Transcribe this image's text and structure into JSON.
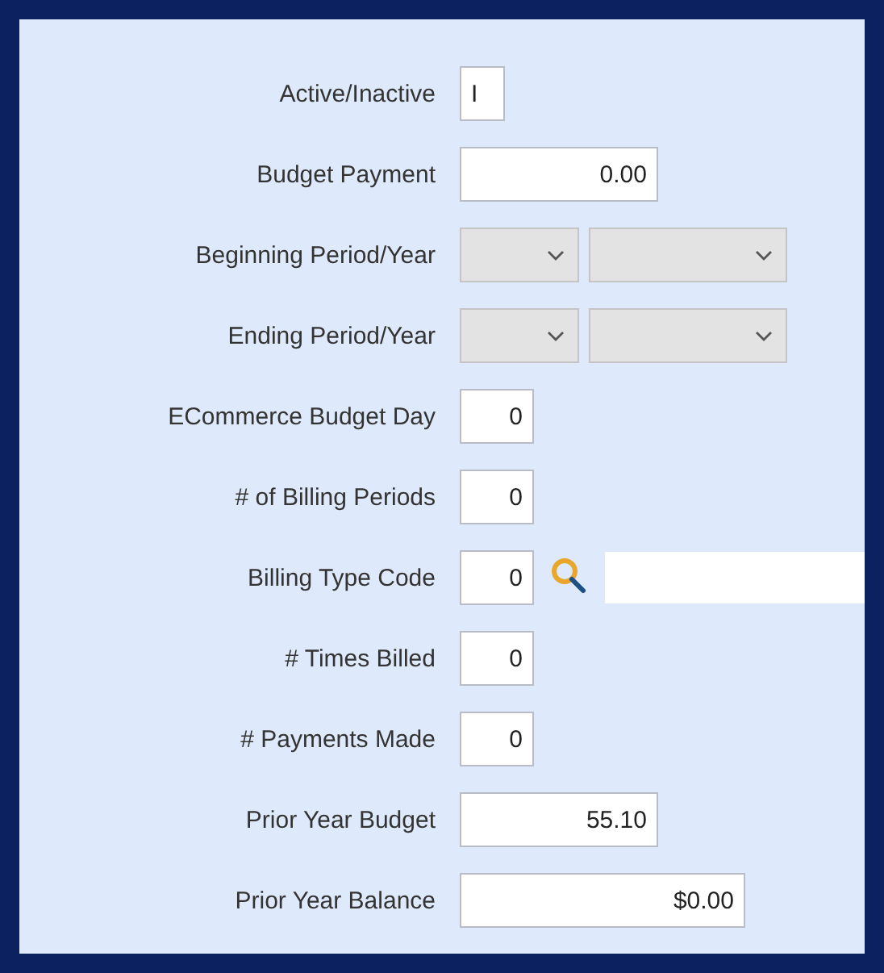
{
  "fields": [
    {
      "kind": "text",
      "label": "Active/Inactive",
      "value": "I"
    },
    {
      "kind": "text",
      "label": "Budget Payment",
      "value": "0.00"
    },
    {
      "kind": "period",
      "label": "Beginning Period/Year",
      "disabled": true
    },
    {
      "kind": "period",
      "label": "Ending Period/Year",
      "disabled": true
    },
    {
      "kind": "text",
      "label": "ECommerce Budget Day",
      "value": "0"
    },
    {
      "kind": "text",
      "label": "# of Billing Periods",
      "value": "0"
    },
    {
      "kind": "lookup",
      "label": "Billing Type Code",
      "value": "0"
    },
    {
      "kind": "text",
      "label": "# Times Billed",
      "value": "0"
    },
    {
      "kind": "text",
      "label": "# Payments Made",
      "value": "0"
    },
    {
      "kind": "text",
      "label": "Prior Year Budget",
      "value": "55.10"
    },
    {
      "kind": "text",
      "label": "Prior Year Balance",
      "value": "$0.00"
    }
  ]
}
